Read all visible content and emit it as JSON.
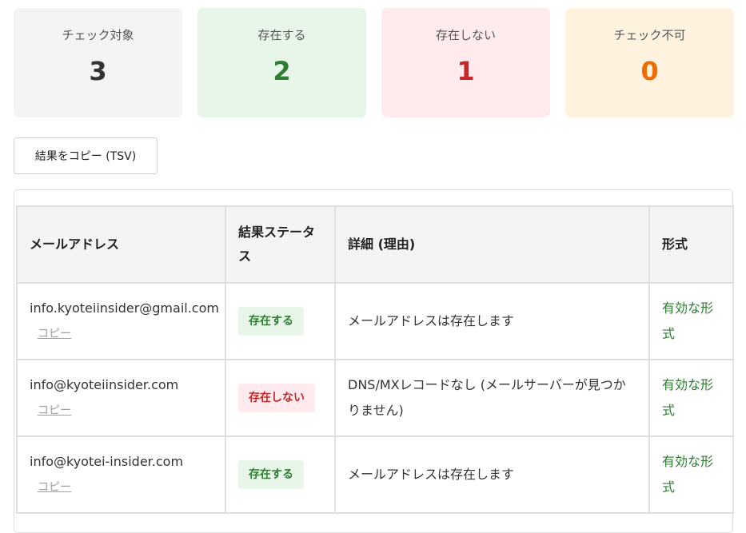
{
  "summary": {
    "total": {
      "label": "チェック対象",
      "value": "3"
    },
    "exists": {
      "label": "存在する",
      "value": "2"
    },
    "missing": {
      "label": "存在しない",
      "value": "1"
    },
    "unknown": {
      "label": "チェック不可",
      "value": "0"
    }
  },
  "actions": {
    "copy_tsv_label": "結果をコピー (TSV)"
  },
  "table": {
    "headers": {
      "email": "メールアドレス",
      "status": "結果ステータス",
      "detail": "詳細 (理由)",
      "format": "形式"
    },
    "copy_label": "コピー",
    "rows": [
      {
        "email": "info.kyoteiinsider@gmail.com",
        "status": "存在する",
        "detail": "メールアドレスは存在します",
        "format": "有効な形式"
      },
      {
        "email": "info@kyoteiinsider.com",
        "status": "存在しない",
        "detail": "DNS/MXレコードなし (メールサーバーが見つかりません)",
        "format": "有効な形式"
      },
      {
        "email": "info@kyotei-insider.com",
        "status": "存在する",
        "detail": "メールアドレスは存在します",
        "format": "有効な形式"
      }
    ]
  },
  "colors": {
    "exists": "#2e7d32",
    "missing": "#c62828",
    "unknown": "#ef6c00",
    "copy_link": "#9e9e9e"
  }
}
